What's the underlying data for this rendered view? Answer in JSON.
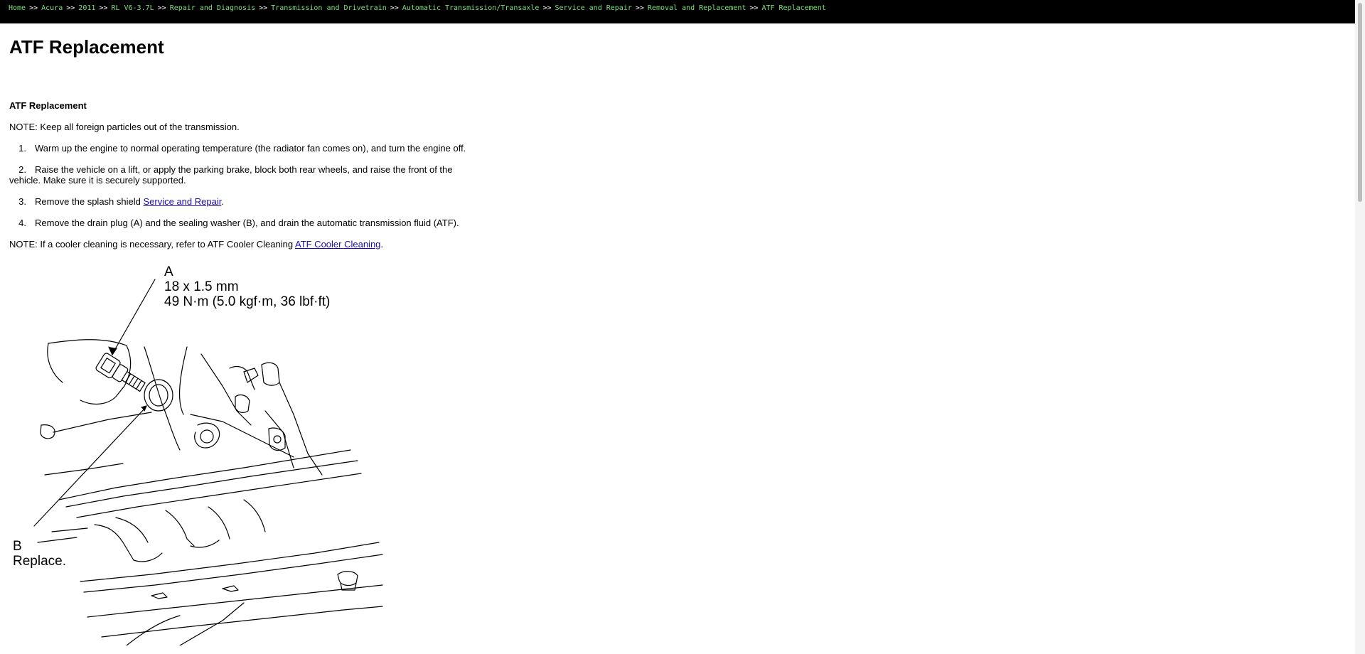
{
  "breadcrumb": {
    "items": [
      "Home",
      "Acura",
      "2011",
      "RL V6-3.7L",
      "Repair and Diagnosis",
      "Transmission and Drivetrain",
      "Automatic Transmission/Transaxle",
      "Service and Repair",
      "Removal and Replacement"
    ],
    "separator": ">>",
    "current": "ATF Replacement"
  },
  "page": {
    "title": "ATF Replacement",
    "section_title": "ATF Replacement",
    "note1": "NOTE: Keep all foreign particles out of the transmission.",
    "steps": [
      {
        "num": "1.",
        "text": "Warm up the engine to normal operating temperature (the radiator fan comes on), and turn the engine off."
      },
      {
        "num": "2.",
        "text_a": "Raise the vehicle on a lift, or apply the parking brake, block both rear wheels, and raise the front of the",
        "text_b": "vehicle. Make sure it is securely supported."
      },
      {
        "num": "3.",
        "text": "Remove the splash shield ",
        "link": "Service and Repair",
        "after": "."
      },
      {
        "num": "4.",
        "text": "Remove the drain plug (A) and the sealing washer (B), and drain the automatic transmission fluid (ATF)."
      }
    ],
    "note2": {
      "text": "NOTE: If a cooler cleaning is necessary, refer to ATF Cooler Cleaning ",
      "link": "ATF Cooler Cleaning",
      "after": "."
    }
  },
  "diagram": {
    "label_a": "A",
    "spec_size": "18 x 1.5 mm",
    "spec_torque": "49 N·m (5.0 kgf·m, 36 lbf·ft)",
    "label_b": "B",
    "replace": "Replace."
  },
  "colors": {
    "crumb_bg": "#000000",
    "crumb_link": "#7ae07a",
    "link": "#1a0dab"
  }
}
